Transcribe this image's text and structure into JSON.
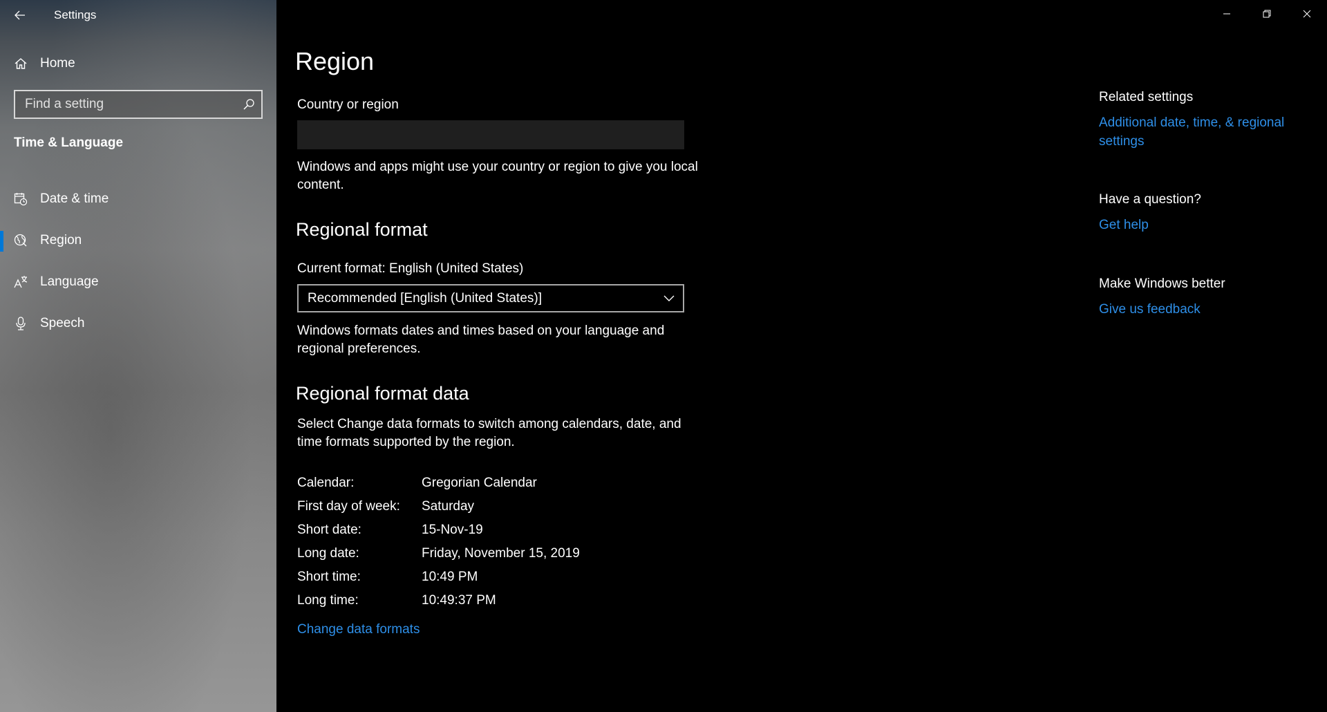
{
  "titlebar": {
    "app_title": "Settings"
  },
  "sidebar": {
    "home_label": "Home",
    "search_placeholder": "Find a setting",
    "section_title": "Time & Language",
    "items": [
      {
        "label": "Date & time",
        "icon": "calendar-clock-icon"
      },
      {
        "label": "Region",
        "icon": "globe-icon",
        "active": true
      },
      {
        "label": "Language",
        "icon": "language-icon"
      },
      {
        "label": "Speech",
        "icon": "microphone-icon"
      }
    ]
  },
  "main": {
    "page_title": "Region",
    "country": {
      "label": "Country or region",
      "value": "",
      "description": "Windows and apps might use your country or region to give you local content."
    },
    "regional_format": {
      "heading": "Regional format",
      "current_label": "Current format: English (United States)",
      "dropdown_value": "Recommended [English (United States)]",
      "description": "Windows formats dates and times based on your language and regional preferences."
    },
    "format_data": {
      "heading": "Regional format data",
      "description": "Select Change data formats to switch among calendars, date, and time formats supported by the region.",
      "rows": [
        {
          "key": "Calendar:",
          "value": "Gregorian Calendar"
        },
        {
          "key": "First day of week:",
          "value": "Saturday"
        },
        {
          "key": "Short date:",
          "value": "15-Nov-19"
        },
        {
          "key": "Long date:",
          "value": "Friday, November 15, 2019"
        },
        {
          "key": "Short time:",
          "value": "10:49 PM"
        },
        {
          "key": "Long time:",
          "value": "10:49:37 PM"
        }
      ],
      "change_link": "Change data formats"
    }
  },
  "related": {
    "heading": "Related settings",
    "link": "Additional date, time, & regional settings",
    "question_heading": "Have a question?",
    "help_link": "Get help",
    "better_heading": "Make Windows better",
    "feedback_link": "Give us feedback"
  },
  "colors": {
    "accent": "#0078d7",
    "link": "#2e8fe8"
  }
}
